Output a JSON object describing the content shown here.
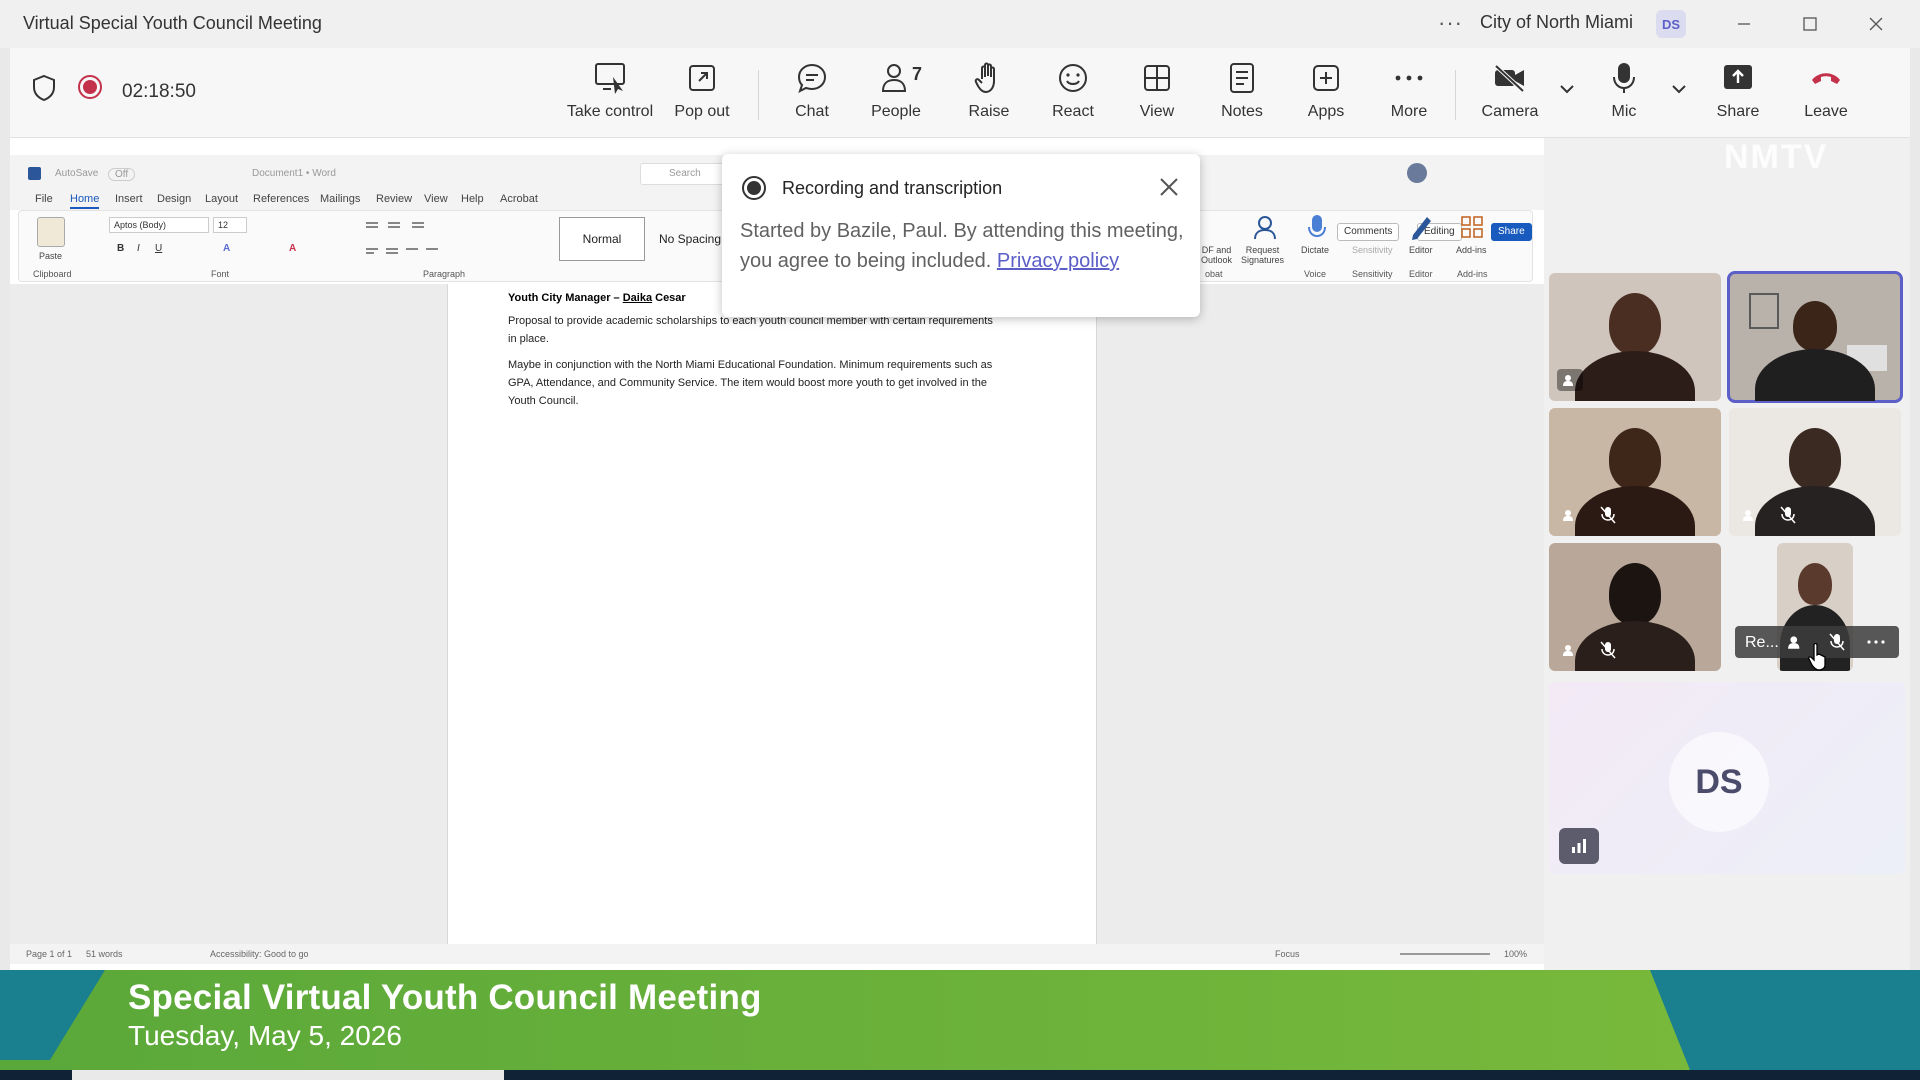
{
  "window": {
    "title": "Virtual Special Youth Council Meeting",
    "more_label": "···",
    "org": "City of North Miami",
    "user_initials": "DS"
  },
  "toolbar": {
    "timer": "02:18:50",
    "buttons": {
      "take_control": "Take control",
      "pop_out": "Pop out",
      "chat": "Chat",
      "people": "People",
      "people_count": "7",
      "raise": "Raise",
      "react": "React",
      "view": "View",
      "notes": "Notes",
      "apps": "Apps",
      "more": "More",
      "camera": "Camera",
      "mic": "Mic",
      "share": "Share",
      "leave": "Leave"
    },
    "colors": {
      "record": "#c4314b",
      "leave": "#c4314b"
    }
  },
  "word": {
    "autosave": "AutoSave",
    "autosave_state": "Off",
    "doc_name": "Document1 • Word",
    "search_placeholder": "Search",
    "menu": [
      "File",
      "Home",
      "Insert",
      "Design",
      "Layout",
      "References",
      "Mailings",
      "Review",
      "View",
      "Help",
      "Acrobat"
    ],
    "active_menu": "Home",
    "font_name": "Aptos (Body)",
    "font_size": "12",
    "paste_label": "Paste",
    "groups": {
      "clipboard": "Clipboard",
      "font": "Font",
      "paragraph": "Paragraph",
      "acrobat": "obat",
      "voice": "Voice",
      "sensitivity": "Sensitivity",
      "editor": "Editor",
      "addins": "Add-ins"
    },
    "styles": [
      "Normal",
      "No Spacing"
    ],
    "ribbon_right": {
      "comments": "Comments",
      "editing": "Editing",
      "share": "Share",
      "pdf_outlook": "DF and\nOutlook",
      "request_signatures": "Request\nSignatures",
      "dictate": "Dictate",
      "sensitivity": "Sensitivity",
      "editor": "Editor",
      "addins": "Add-ins"
    },
    "doc": {
      "heading_prefix": "Youth City Manager – ",
      "heading_name": "Daika",
      "heading_suffix": " Cesar",
      "p1": "Proposal to provide academic scholarships to each youth council member with certain requirements in place.",
      "p2": "Maybe in conjunction with the North Miami Educational Foundation. Minimum requirements such as GPA, Attendance, and Community Service. The item would boost more youth to get involved in the Youth Council."
    },
    "status": {
      "page": "Page 1 of 1",
      "words": "51 words",
      "accessibility": "Accessibility: Good to go",
      "focus": "Focus",
      "zoom": "100%"
    }
  },
  "popup": {
    "title": "Recording and transcription",
    "body": "Started by Bazile, Paul. By attending this meeting, you agree to being included.",
    "link": "Privacy policy"
  },
  "participants": {
    "pill_name": "Re...",
    "self_initials": "DS",
    "watermark": "NMTV"
  },
  "banner": {
    "title": "Special Virtual Youth Council Meeting",
    "date": "Tuesday, May 5, 2026"
  }
}
